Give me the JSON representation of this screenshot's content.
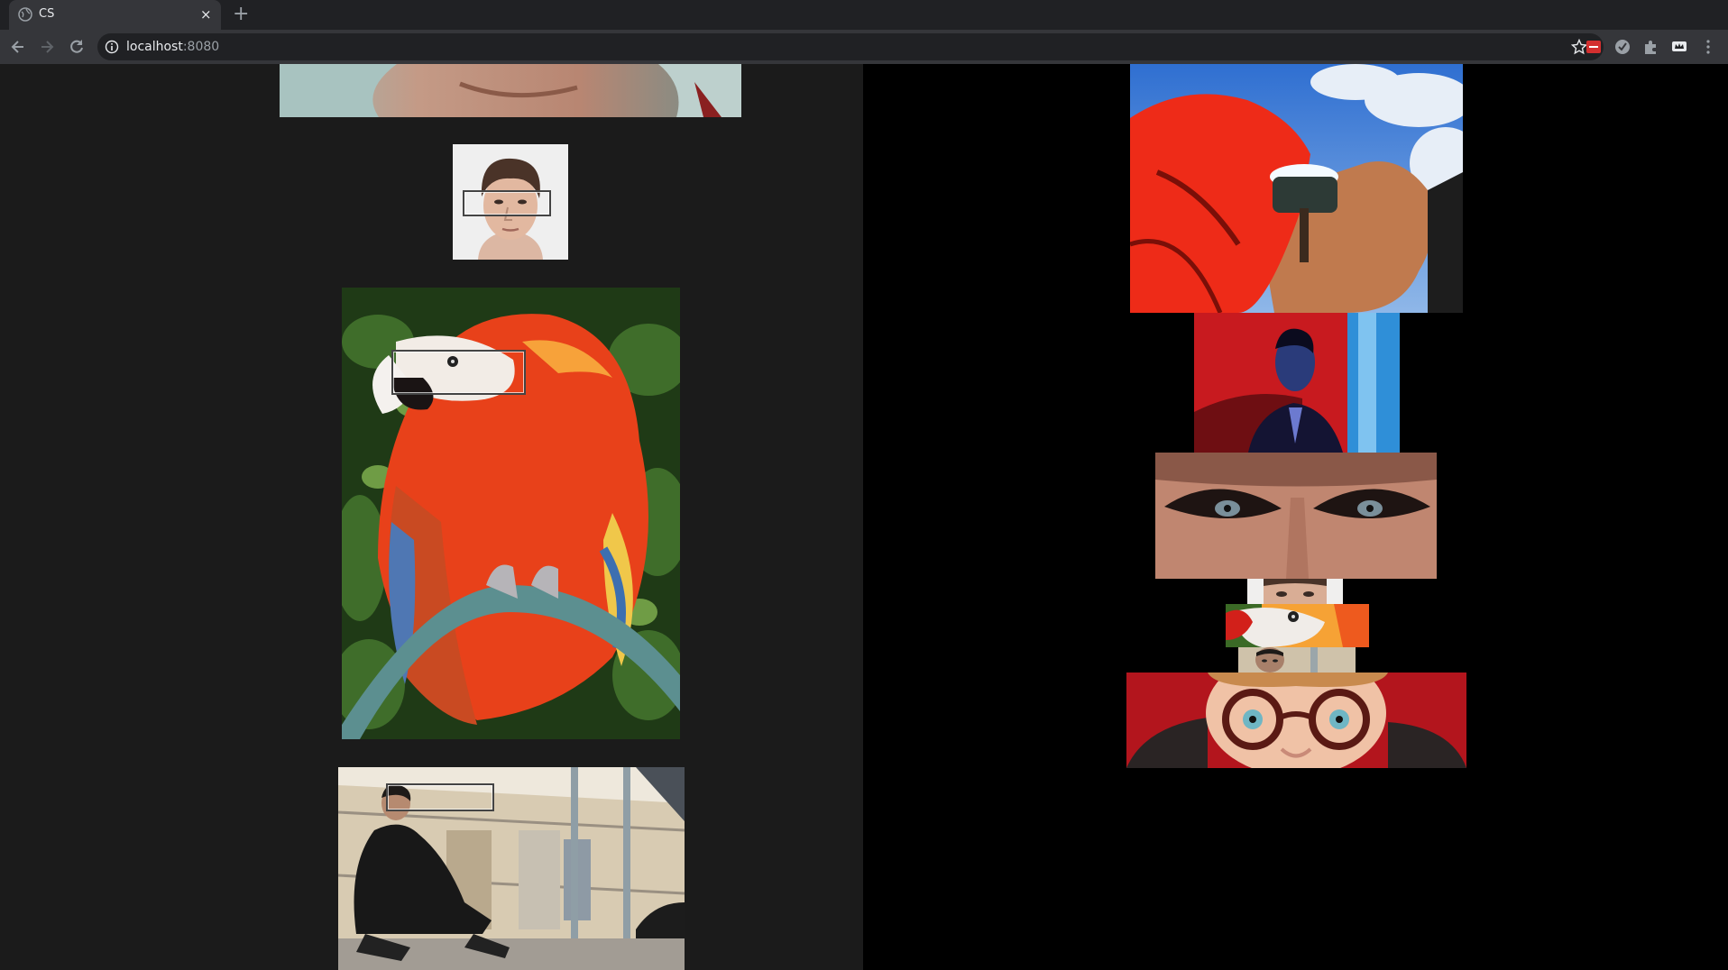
{
  "browser": {
    "tab_title": "CS",
    "url_host": "localhost",
    "url_port": ":8080",
    "close_glyph": "×",
    "newtab_glyph": "+"
  },
  "left_images": [
    {
      "name": "cropped-face-top",
      "description": "partial face crop at top of page"
    },
    {
      "name": "man-portrait",
      "has_detection_box": true
    },
    {
      "name": "scarlet-macaw",
      "has_detection_box": true
    },
    {
      "name": "man-sitting-motel",
      "has_detection_box": true
    }
  ],
  "right_images": [
    {
      "name": "anime-eye-patch"
    },
    {
      "name": "man-red-room"
    },
    {
      "name": "eyes-closeup"
    },
    {
      "name": "crop-man-portrait-eyes"
    },
    {
      "name": "crop-macaw-eye"
    },
    {
      "name": "crop-sitting-man-eyes"
    },
    {
      "name": "boy-red-glasses"
    }
  ],
  "colors": {
    "left_background": "#1b1b1b",
    "right_background": "#000000",
    "chrome_dark": "#202124",
    "chrome_toolbar": "#35363a"
  },
  "icons": [
    "globe-icon",
    "close-icon",
    "plus-icon",
    "back-arrow-icon",
    "forward-arrow-icon",
    "reload-icon",
    "info-icon",
    "star-icon",
    "extension-red-icon",
    "extension-circle-icon",
    "puzzle-icon",
    "extension-crown-icon",
    "kebab-menu-icon"
  ]
}
